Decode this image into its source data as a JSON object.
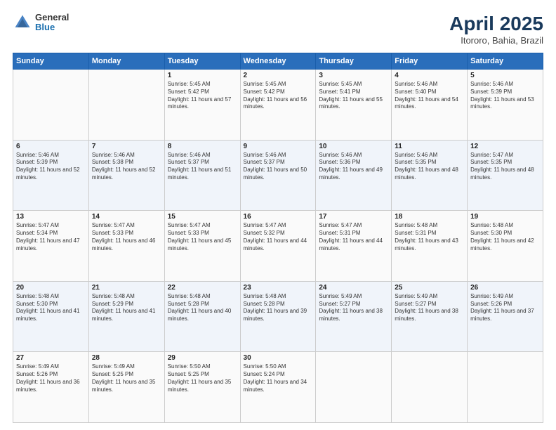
{
  "header": {
    "logo": {
      "general": "General",
      "blue": "Blue"
    },
    "title": "April 2025",
    "location": "Itororo, Bahia, Brazil"
  },
  "days_of_week": [
    "Sunday",
    "Monday",
    "Tuesday",
    "Wednesday",
    "Thursday",
    "Friday",
    "Saturday"
  ],
  "weeks": [
    [
      {
        "day": "",
        "info": ""
      },
      {
        "day": "",
        "info": ""
      },
      {
        "day": "1",
        "info": "Sunrise: 5:45 AM\nSunset: 5:42 PM\nDaylight: 11 hours and 57 minutes."
      },
      {
        "day": "2",
        "info": "Sunrise: 5:45 AM\nSunset: 5:42 PM\nDaylight: 11 hours and 56 minutes."
      },
      {
        "day": "3",
        "info": "Sunrise: 5:45 AM\nSunset: 5:41 PM\nDaylight: 11 hours and 55 minutes."
      },
      {
        "day": "4",
        "info": "Sunrise: 5:46 AM\nSunset: 5:40 PM\nDaylight: 11 hours and 54 minutes."
      },
      {
        "day": "5",
        "info": "Sunrise: 5:46 AM\nSunset: 5:39 PM\nDaylight: 11 hours and 53 minutes."
      }
    ],
    [
      {
        "day": "6",
        "info": "Sunrise: 5:46 AM\nSunset: 5:39 PM\nDaylight: 11 hours and 52 minutes."
      },
      {
        "day": "7",
        "info": "Sunrise: 5:46 AM\nSunset: 5:38 PM\nDaylight: 11 hours and 52 minutes."
      },
      {
        "day": "8",
        "info": "Sunrise: 5:46 AM\nSunset: 5:37 PM\nDaylight: 11 hours and 51 minutes."
      },
      {
        "day": "9",
        "info": "Sunrise: 5:46 AM\nSunset: 5:37 PM\nDaylight: 11 hours and 50 minutes."
      },
      {
        "day": "10",
        "info": "Sunrise: 5:46 AM\nSunset: 5:36 PM\nDaylight: 11 hours and 49 minutes."
      },
      {
        "day": "11",
        "info": "Sunrise: 5:46 AM\nSunset: 5:35 PM\nDaylight: 11 hours and 48 minutes."
      },
      {
        "day": "12",
        "info": "Sunrise: 5:47 AM\nSunset: 5:35 PM\nDaylight: 11 hours and 48 minutes."
      }
    ],
    [
      {
        "day": "13",
        "info": "Sunrise: 5:47 AM\nSunset: 5:34 PM\nDaylight: 11 hours and 47 minutes."
      },
      {
        "day": "14",
        "info": "Sunrise: 5:47 AM\nSunset: 5:33 PM\nDaylight: 11 hours and 46 minutes."
      },
      {
        "day": "15",
        "info": "Sunrise: 5:47 AM\nSunset: 5:33 PM\nDaylight: 11 hours and 45 minutes."
      },
      {
        "day": "16",
        "info": "Sunrise: 5:47 AM\nSunset: 5:32 PM\nDaylight: 11 hours and 44 minutes."
      },
      {
        "day": "17",
        "info": "Sunrise: 5:47 AM\nSunset: 5:31 PM\nDaylight: 11 hours and 44 minutes."
      },
      {
        "day": "18",
        "info": "Sunrise: 5:48 AM\nSunset: 5:31 PM\nDaylight: 11 hours and 43 minutes."
      },
      {
        "day": "19",
        "info": "Sunrise: 5:48 AM\nSunset: 5:30 PM\nDaylight: 11 hours and 42 minutes."
      }
    ],
    [
      {
        "day": "20",
        "info": "Sunrise: 5:48 AM\nSunset: 5:30 PM\nDaylight: 11 hours and 41 minutes."
      },
      {
        "day": "21",
        "info": "Sunrise: 5:48 AM\nSunset: 5:29 PM\nDaylight: 11 hours and 41 minutes."
      },
      {
        "day": "22",
        "info": "Sunrise: 5:48 AM\nSunset: 5:28 PM\nDaylight: 11 hours and 40 minutes."
      },
      {
        "day": "23",
        "info": "Sunrise: 5:48 AM\nSunset: 5:28 PM\nDaylight: 11 hours and 39 minutes."
      },
      {
        "day": "24",
        "info": "Sunrise: 5:49 AM\nSunset: 5:27 PM\nDaylight: 11 hours and 38 minutes."
      },
      {
        "day": "25",
        "info": "Sunrise: 5:49 AM\nSunset: 5:27 PM\nDaylight: 11 hours and 38 minutes."
      },
      {
        "day": "26",
        "info": "Sunrise: 5:49 AM\nSunset: 5:26 PM\nDaylight: 11 hours and 37 minutes."
      }
    ],
    [
      {
        "day": "27",
        "info": "Sunrise: 5:49 AM\nSunset: 5:26 PM\nDaylight: 11 hours and 36 minutes."
      },
      {
        "day": "28",
        "info": "Sunrise: 5:49 AM\nSunset: 5:25 PM\nDaylight: 11 hours and 35 minutes."
      },
      {
        "day": "29",
        "info": "Sunrise: 5:50 AM\nSunset: 5:25 PM\nDaylight: 11 hours and 35 minutes."
      },
      {
        "day": "30",
        "info": "Sunrise: 5:50 AM\nSunset: 5:24 PM\nDaylight: 11 hours and 34 minutes."
      },
      {
        "day": "",
        "info": ""
      },
      {
        "day": "",
        "info": ""
      },
      {
        "day": "",
        "info": ""
      }
    ]
  ]
}
